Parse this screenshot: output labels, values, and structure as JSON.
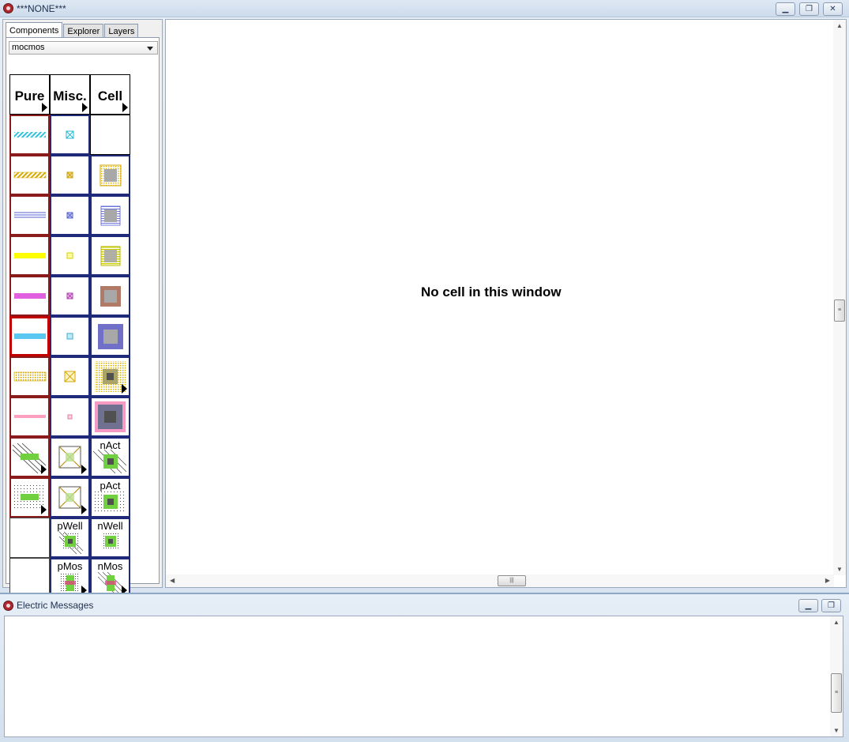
{
  "main_window": {
    "title": "***NONE***",
    "buttons": {
      "minimize": "minimize",
      "restore": "restore",
      "close": "close"
    }
  },
  "left_panel": {
    "tabs": [
      {
        "label": "Components",
        "active": true
      },
      {
        "label": "Explorer",
        "active": false
      },
      {
        "label": "Layers",
        "active": false
      }
    ],
    "technology_select": {
      "value": "mocmos"
    },
    "palette_headers": [
      "Pure",
      "Misc.",
      "Cell"
    ],
    "cell_labels": {
      "nact": "nAct",
      "pact": "pAct",
      "pwell": "pWell",
      "nwell": "nWell",
      "pmos": "pMos",
      "nmos": "nMos"
    }
  },
  "canvas": {
    "message": "No cell in this window"
  },
  "messages_window": {
    "title": "Electric Messages",
    "content": ""
  },
  "colors": {
    "pure_border": "#8b1a1a",
    "misc_border": "#1f2a7a",
    "poly": "#ffff00",
    "metal1": "#5ac8f0",
    "metal2": "#e060e0",
    "select": "#ff9fbf",
    "active": "#70d040"
  }
}
